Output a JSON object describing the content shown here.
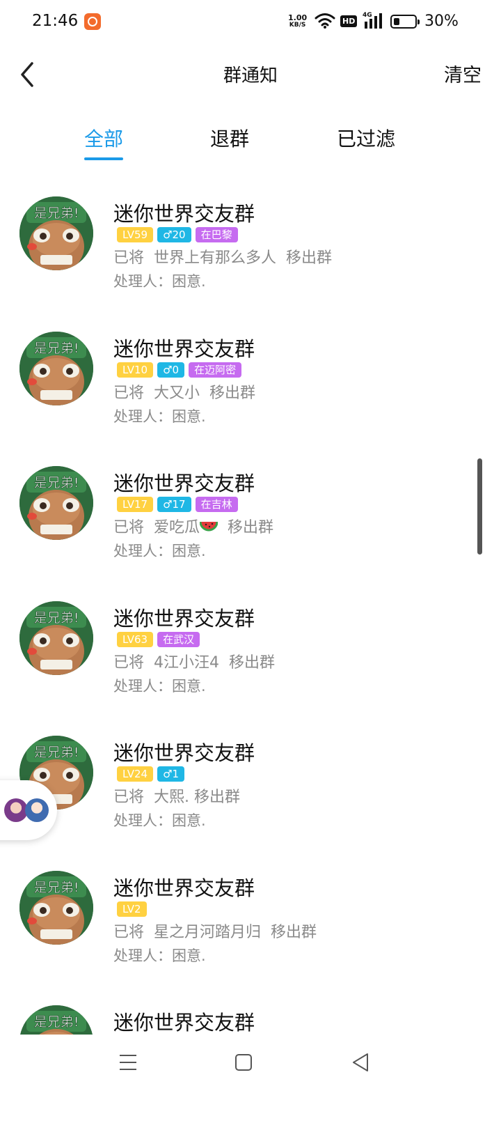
{
  "status_bar": {
    "time": "21:46",
    "speed_value": "1.00",
    "speed_unit": "KB/S",
    "hd": "HD",
    "network": "4G",
    "battery": "30%",
    "battery_level": 0.3
  },
  "header": {
    "title": "群通知",
    "clear_label": "清空"
  },
  "tabs": [
    {
      "label": "全部",
      "active": true
    },
    {
      "label": "退群",
      "active": false
    },
    {
      "label": "已过滤",
      "active": false
    }
  ],
  "avatar_caption": "是兄弟!",
  "notifications": [
    {
      "group": "迷你世界交友群",
      "level": "LV59",
      "gender": "♂20",
      "location": "在巴黎",
      "action": "已将  世界上有那么多人  移出群",
      "handler": "处理人：困意."
    },
    {
      "group": "迷你世界交友群",
      "level": "LV10",
      "gender": "♂0",
      "location": "在迈阿密",
      "action": "已将  大又小  移出群",
      "handler": "处理人：困意."
    },
    {
      "group": "迷你世界交友群",
      "level": "LV17",
      "gender": "♂17",
      "location": "在吉林",
      "action_prefix": "已将  爱吃瓜",
      "action_suffix": "  移出群",
      "has_melon": true,
      "handler": "处理人：困意."
    },
    {
      "group": "迷你世界交友群",
      "level": "LV63",
      "location": "在武汉",
      "action": "已将  4江小汪4  移出群",
      "handler": "处理人：困意."
    },
    {
      "group": "迷你世界交友群",
      "level": "LV24",
      "gender": "♂1",
      "action": "已将  大熙. 移出群",
      "handler": "处理人：困意."
    },
    {
      "group": "迷你世界交友群",
      "level": "LV2",
      "action": "已将  星之月河踏月归  移出群",
      "handler": "处理人：困意."
    },
    {
      "group": "迷你世界交友群"
    }
  ],
  "colors": {
    "accent": "#1a9ae8",
    "level_tag": "#ffd141",
    "gender_tag": "#1fb7e5",
    "location_tag": "#c66bf0",
    "secondary_text": "#8a8a8a"
  },
  "icons": {
    "back": "chevron-left-icon",
    "nav_menu": "menu-icon",
    "nav_home": "square-icon",
    "nav_back": "triangle-back-icon"
  }
}
